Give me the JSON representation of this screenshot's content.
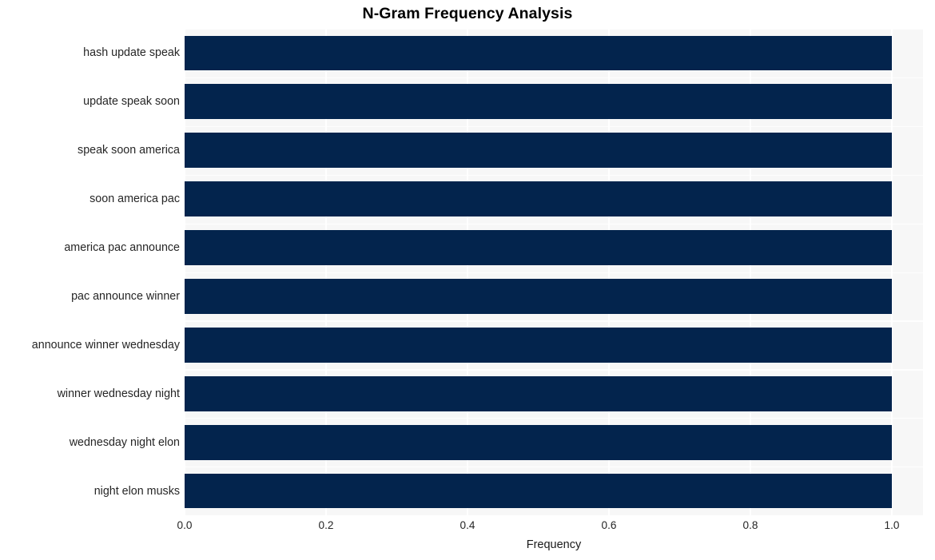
{
  "chart_data": {
    "type": "bar",
    "orientation": "horizontal",
    "title": "N-Gram Frequency Analysis",
    "xlabel": "Frequency",
    "ylabel": "",
    "categories": [
      "hash update speak",
      "update speak soon",
      "speak soon america",
      "soon america pac",
      "america pac announce",
      "pac announce winner",
      "announce winner wednesday",
      "winner wednesday night",
      "wednesday night elon",
      "night elon musks"
    ],
    "values": [
      1.0,
      1.0,
      1.0,
      1.0,
      1.0,
      1.0,
      1.0,
      1.0,
      1.0,
      1.0
    ],
    "xlim": [
      0.0,
      1.0
    ],
    "xticks": [
      "0.0",
      "0.2",
      "0.4",
      "0.6",
      "0.8",
      "1.0"
    ],
    "xtick_values": [
      0.0,
      0.2,
      0.4,
      0.6,
      0.8,
      1.0
    ],
    "grid": true,
    "legend": null,
    "bar_color": "#03244d",
    "plot_background": "#f7f7f7",
    "figure_background": "#ffffff",
    "gridline_color": "#ffffff",
    "title_color": "#000000",
    "tick_label_color": "#262626"
  }
}
